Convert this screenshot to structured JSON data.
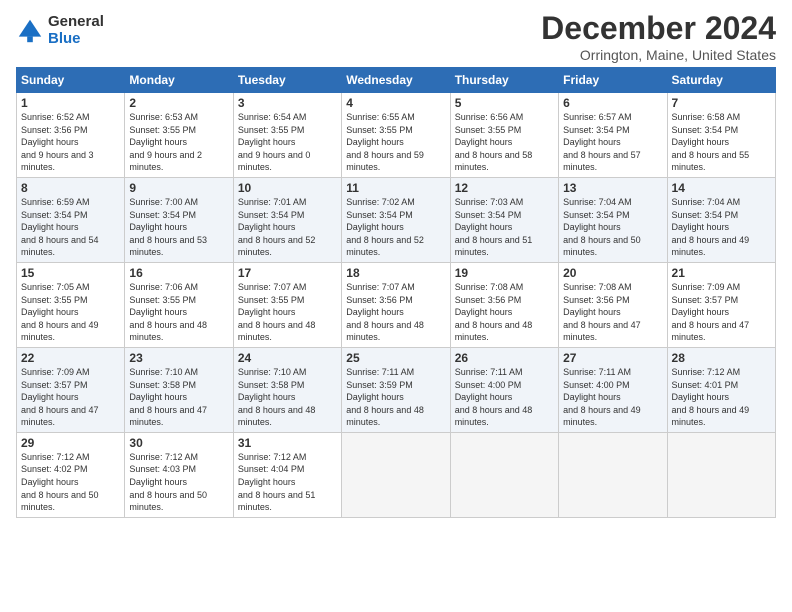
{
  "header": {
    "logo_general": "General",
    "logo_blue": "Blue",
    "month_title": "December 2024",
    "location": "Orrington, Maine, United States"
  },
  "days_of_week": [
    "Sunday",
    "Monday",
    "Tuesday",
    "Wednesday",
    "Thursday",
    "Friday",
    "Saturday"
  ],
  "weeks": [
    [
      {
        "num": "1",
        "sunrise": "6:52 AM",
        "sunset": "3:56 PM",
        "daylight": "9 hours and 3 minutes."
      },
      {
        "num": "2",
        "sunrise": "6:53 AM",
        "sunset": "3:55 PM",
        "daylight": "9 hours and 2 minutes."
      },
      {
        "num": "3",
        "sunrise": "6:54 AM",
        "sunset": "3:55 PM",
        "daylight": "9 hours and 0 minutes."
      },
      {
        "num": "4",
        "sunrise": "6:55 AM",
        "sunset": "3:55 PM",
        "daylight": "8 hours and 59 minutes."
      },
      {
        "num": "5",
        "sunrise": "6:56 AM",
        "sunset": "3:55 PM",
        "daylight": "8 hours and 58 minutes."
      },
      {
        "num": "6",
        "sunrise": "6:57 AM",
        "sunset": "3:54 PM",
        "daylight": "8 hours and 57 minutes."
      },
      {
        "num": "7",
        "sunrise": "6:58 AM",
        "sunset": "3:54 PM",
        "daylight": "8 hours and 55 minutes."
      }
    ],
    [
      {
        "num": "8",
        "sunrise": "6:59 AM",
        "sunset": "3:54 PM",
        "daylight": "8 hours and 54 minutes."
      },
      {
        "num": "9",
        "sunrise": "7:00 AM",
        "sunset": "3:54 PM",
        "daylight": "8 hours and 53 minutes."
      },
      {
        "num": "10",
        "sunrise": "7:01 AM",
        "sunset": "3:54 PM",
        "daylight": "8 hours and 52 minutes."
      },
      {
        "num": "11",
        "sunrise": "7:02 AM",
        "sunset": "3:54 PM",
        "daylight": "8 hours and 52 minutes."
      },
      {
        "num": "12",
        "sunrise": "7:03 AM",
        "sunset": "3:54 PM",
        "daylight": "8 hours and 51 minutes."
      },
      {
        "num": "13",
        "sunrise": "7:04 AM",
        "sunset": "3:54 PM",
        "daylight": "8 hours and 50 minutes."
      },
      {
        "num": "14",
        "sunrise": "7:04 AM",
        "sunset": "3:54 PM",
        "daylight": "8 hours and 49 minutes."
      }
    ],
    [
      {
        "num": "15",
        "sunrise": "7:05 AM",
        "sunset": "3:55 PM",
        "daylight": "8 hours and 49 minutes."
      },
      {
        "num": "16",
        "sunrise": "7:06 AM",
        "sunset": "3:55 PM",
        "daylight": "8 hours and 48 minutes."
      },
      {
        "num": "17",
        "sunrise": "7:07 AM",
        "sunset": "3:55 PM",
        "daylight": "8 hours and 48 minutes."
      },
      {
        "num": "18",
        "sunrise": "7:07 AM",
        "sunset": "3:56 PM",
        "daylight": "8 hours and 48 minutes."
      },
      {
        "num": "19",
        "sunrise": "7:08 AM",
        "sunset": "3:56 PM",
        "daylight": "8 hours and 48 minutes."
      },
      {
        "num": "20",
        "sunrise": "7:08 AM",
        "sunset": "3:56 PM",
        "daylight": "8 hours and 47 minutes."
      },
      {
        "num": "21",
        "sunrise": "7:09 AM",
        "sunset": "3:57 PM",
        "daylight": "8 hours and 47 minutes."
      }
    ],
    [
      {
        "num": "22",
        "sunrise": "7:09 AM",
        "sunset": "3:57 PM",
        "daylight": "8 hours and 47 minutes."
      },
      {
        "num": "23",
        "sunrise": "7:10 AM",
        "sunset": "3:58 PM",
        "daylight": "8 hours and 47 minutes."
      },
      {
        "num": "24",
        "sunrise": "7:10 AM",
        "sunset": "3:58 PM",
        "daylight": "8 hours and 48 minutes."
      },
      {
        "num": "25",
        "sunrise": "7:11 AM",
        "sunset": "3:59 PM",
        "daylight": "8 hours and 48 minutes."
      },
      {
        "num": "26",
        "sunrise": "7:11 AM",
        "sunset": "4:00 PM",
        "daylight": "8 hours and 48 minutes."
      },
      {
        "num": "27",
        "sunrise": "7:11 AM",
        "sunset": "4:00 PM",
        "daylight": "8 hours and 49 minutes."
      },
      {
        "num": "28",
        "sunrise": "7:12 AM",
        "sunset": "4:01 PM",
        "daylight": "8 hours and 49 minutes."
      }
    ],
    [
      {
        "num": "29",
        "sunrise": "7:12 AM",
        "sunset": "4:02 PM",
        "daylight": "8 hours and 50 minutes."
      },
      {
        "num": "30",
        "sunrise": "7:12 AM",
        "sunset": "4:03 PM",
        "daylight": "8 hours and 50 minutes."
      },
      {
        "num": "31",
        "sunrise": "7:12 AM",
        "sunset": "4:04 PM",
        "daylight": "8 hours and 51 minutes."
      },
      null,
      null,
      null,
      null
    ]
  ]
}
